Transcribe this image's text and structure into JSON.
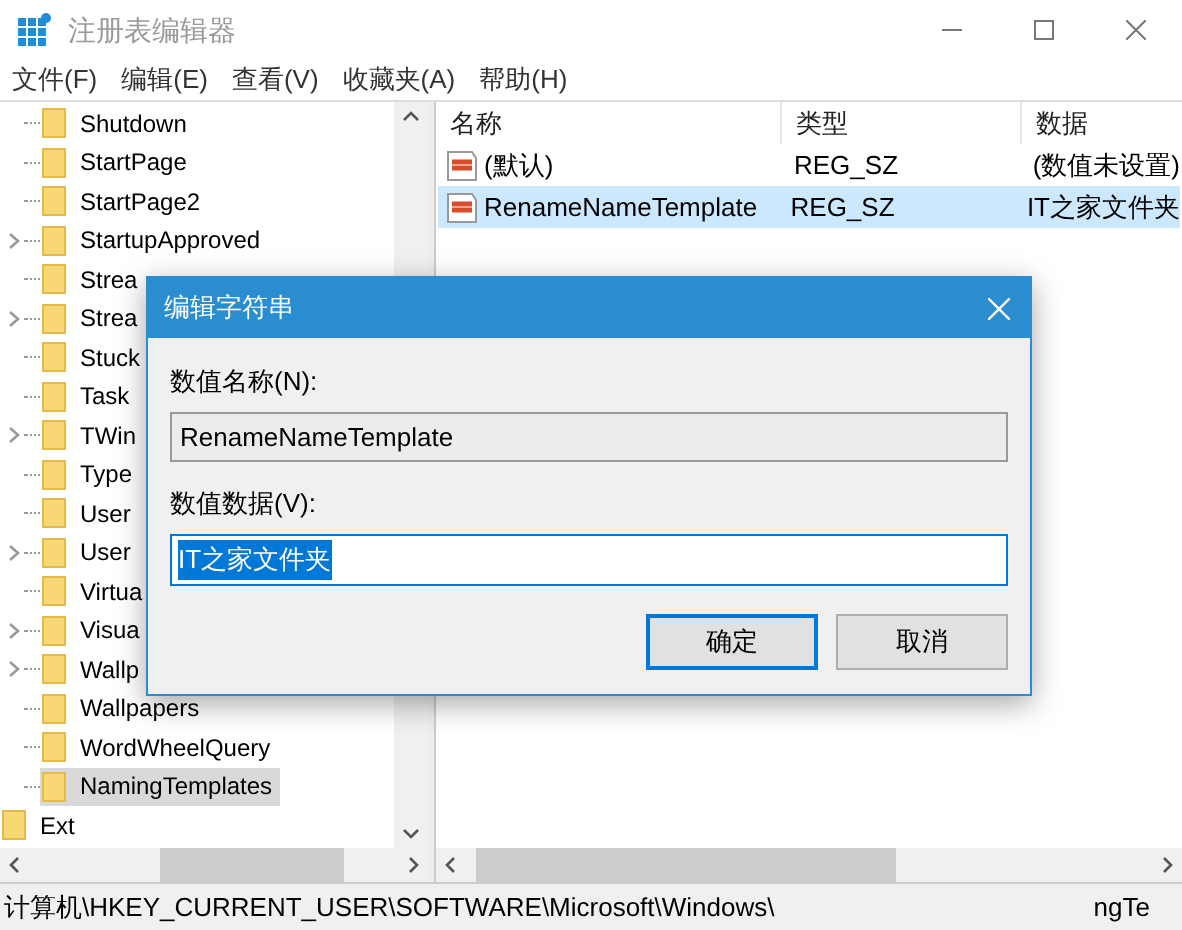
{
  "window": {
    "title": "注册表编辑器"
  },
  "menu": [
    "文件(F)",
    "编辑(E)",
    "查看(V)",
    "收藏夹(A)",
    "帮助(H)"
  ],
  "tree": {
    "branch_items": [
      {
        "label": "Shutdown",
        "expandable": false,
        "selected": false
      },
      {
        "label": "StartPage",
        "expandable": false,
        "selected": false
      },
      {
        "label": "StartPage2",
        "expandable": false,
        "selected": false
      },
      {
        "label": "StartupApproved",
        "expandable": true,
        "selected": false
      },
      {
        "label": "Strea",
        "expandable": false,
        "selected": false
      },
      {
        "label": "Strea",
        "expandable": true,
        "selected": false
      },
      {
        "label": "Stuck",
        "expandable": false,
        "selected": false
      },
      {
        "label": "Task",
        "expandable": false,
        "selected": false
      },
      {
        "label": "TWin",
        "expandable": true,
        "selected": false
      },
      {
        "label": "Type",
        "expandable": false,
        "selected": false
      },
      {
        "label": "User",
        "expandable": false,
        "selected": false
      },
      {
        "label": "User",
        "expandable": true,
        "selected": false
      },
      {
        "label": "Virtua",
        "expandable": false,
        "selected": false
      },
      {
        "label": "Visua",
        "expandable": true,
        "selected": false
      },
      {
        "label": "Wallp",
        "expandable": true,
        "selected": false
      },
      {
        "label": "Wallpapers",
        "expandable": false,
        "selected": false
      },
      {
        "label": "WordWheelQuery",
        "expandable": false,
        "selected": false
      },
      {
        "label": "NamingTemplates",
        "expandable": false,
        "selected": true
      }
    ],
    "next_items": [
      {
        "label": "Ext",
        "selected": false
      }
    ]
  },
  "values": {
    "columns": [
      "名称",
      "类型",
      "数据"
    ],
    "rows": [
      {
        "name": "(默认)",
        "type": "REG_SZ",
        "data": "(数值未设置)",
        "selected": false
      },
      {
        "name": "RenameNameTemplate",
        "type": "REG_SZ",
        "data": "IT之家文件夹",
        "selected": true
      }
    ]
  },
  "dialog": {
    "title": "编辑字符串",
    "name_label": "数值名称(N):",
    "name_value": "RenameNameTemplate",
    "data_label": "数值数据(V):",
    "data_value": "IT之家文件夹",
    "data_selected": true,
    "buttons": [
      {
        "label": "确定",
        "default": true
      },
      {
        "label": "取消",
        "default": false
      }
    ]
  },
  "status_bar": {
    "path": "计算机\\HKEY_CURRENT_USER\\SOFTWARE\\Microsoft\\Windows\\",
    "path_end": "ngTe"
  }
}
